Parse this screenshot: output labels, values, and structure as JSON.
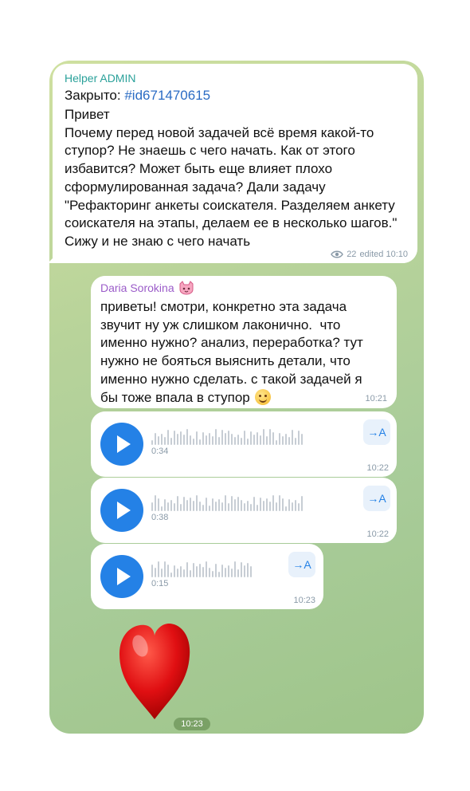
{
  "messages": {
    "admin": {
      "sender": "Helper ADMIN",
      "closed_label": "Закрыто: ",
      "closed_tag": "#id671470615",
      "text": "Привет\nПочему перед новой задачей всё время какой-то ступор? Не знаешь с чего начать. Как от этого избавится? Может быть еще влияет плохо сформулированная задача? Дали задачу \"Рефакторинг анкеты соискателя. Разделяем анкету соискателя на этапы, делаем ее в несколько шагов.\" Сижу и не знаю с чего начать",
      "views": "22",
      "edited_time": "edited 10:10"
    },
    "daria": {
      "sender": "Daria Sorokina",
      "text": "приветы! смотри, конкретно эта задача звучит ну уж слишком лаконично.  что именно нужно? анализ, переработка? тут нужно не бояться выяснить детали, что именно нужно сделать. с такой задачей я бы тоже впала в ступор",
      "time": "10:21"
    },
    "voices": [
      {
        "duration": "0:34",
        "time": "10:22",
        "translate_label": "→A"
      },
      {
        "duration": "0:38",
        "time": "10:22",
        "translate_label": "→A"
      },
      {
        "duration": "0:15",
        "time": "10:23",
        "translate_label": "→A"
      }
    ],
    "sticker": {
      "emoji_name": "red-heart",
      "time": "10:23"
    }
  },
  "colors": {
    "admin_name": "#2aa19a",
    "daria_name": "#9b5cc9",
    "accent": "#2481e6",
    "hashtag": "#2b6cc4"
  }
}
